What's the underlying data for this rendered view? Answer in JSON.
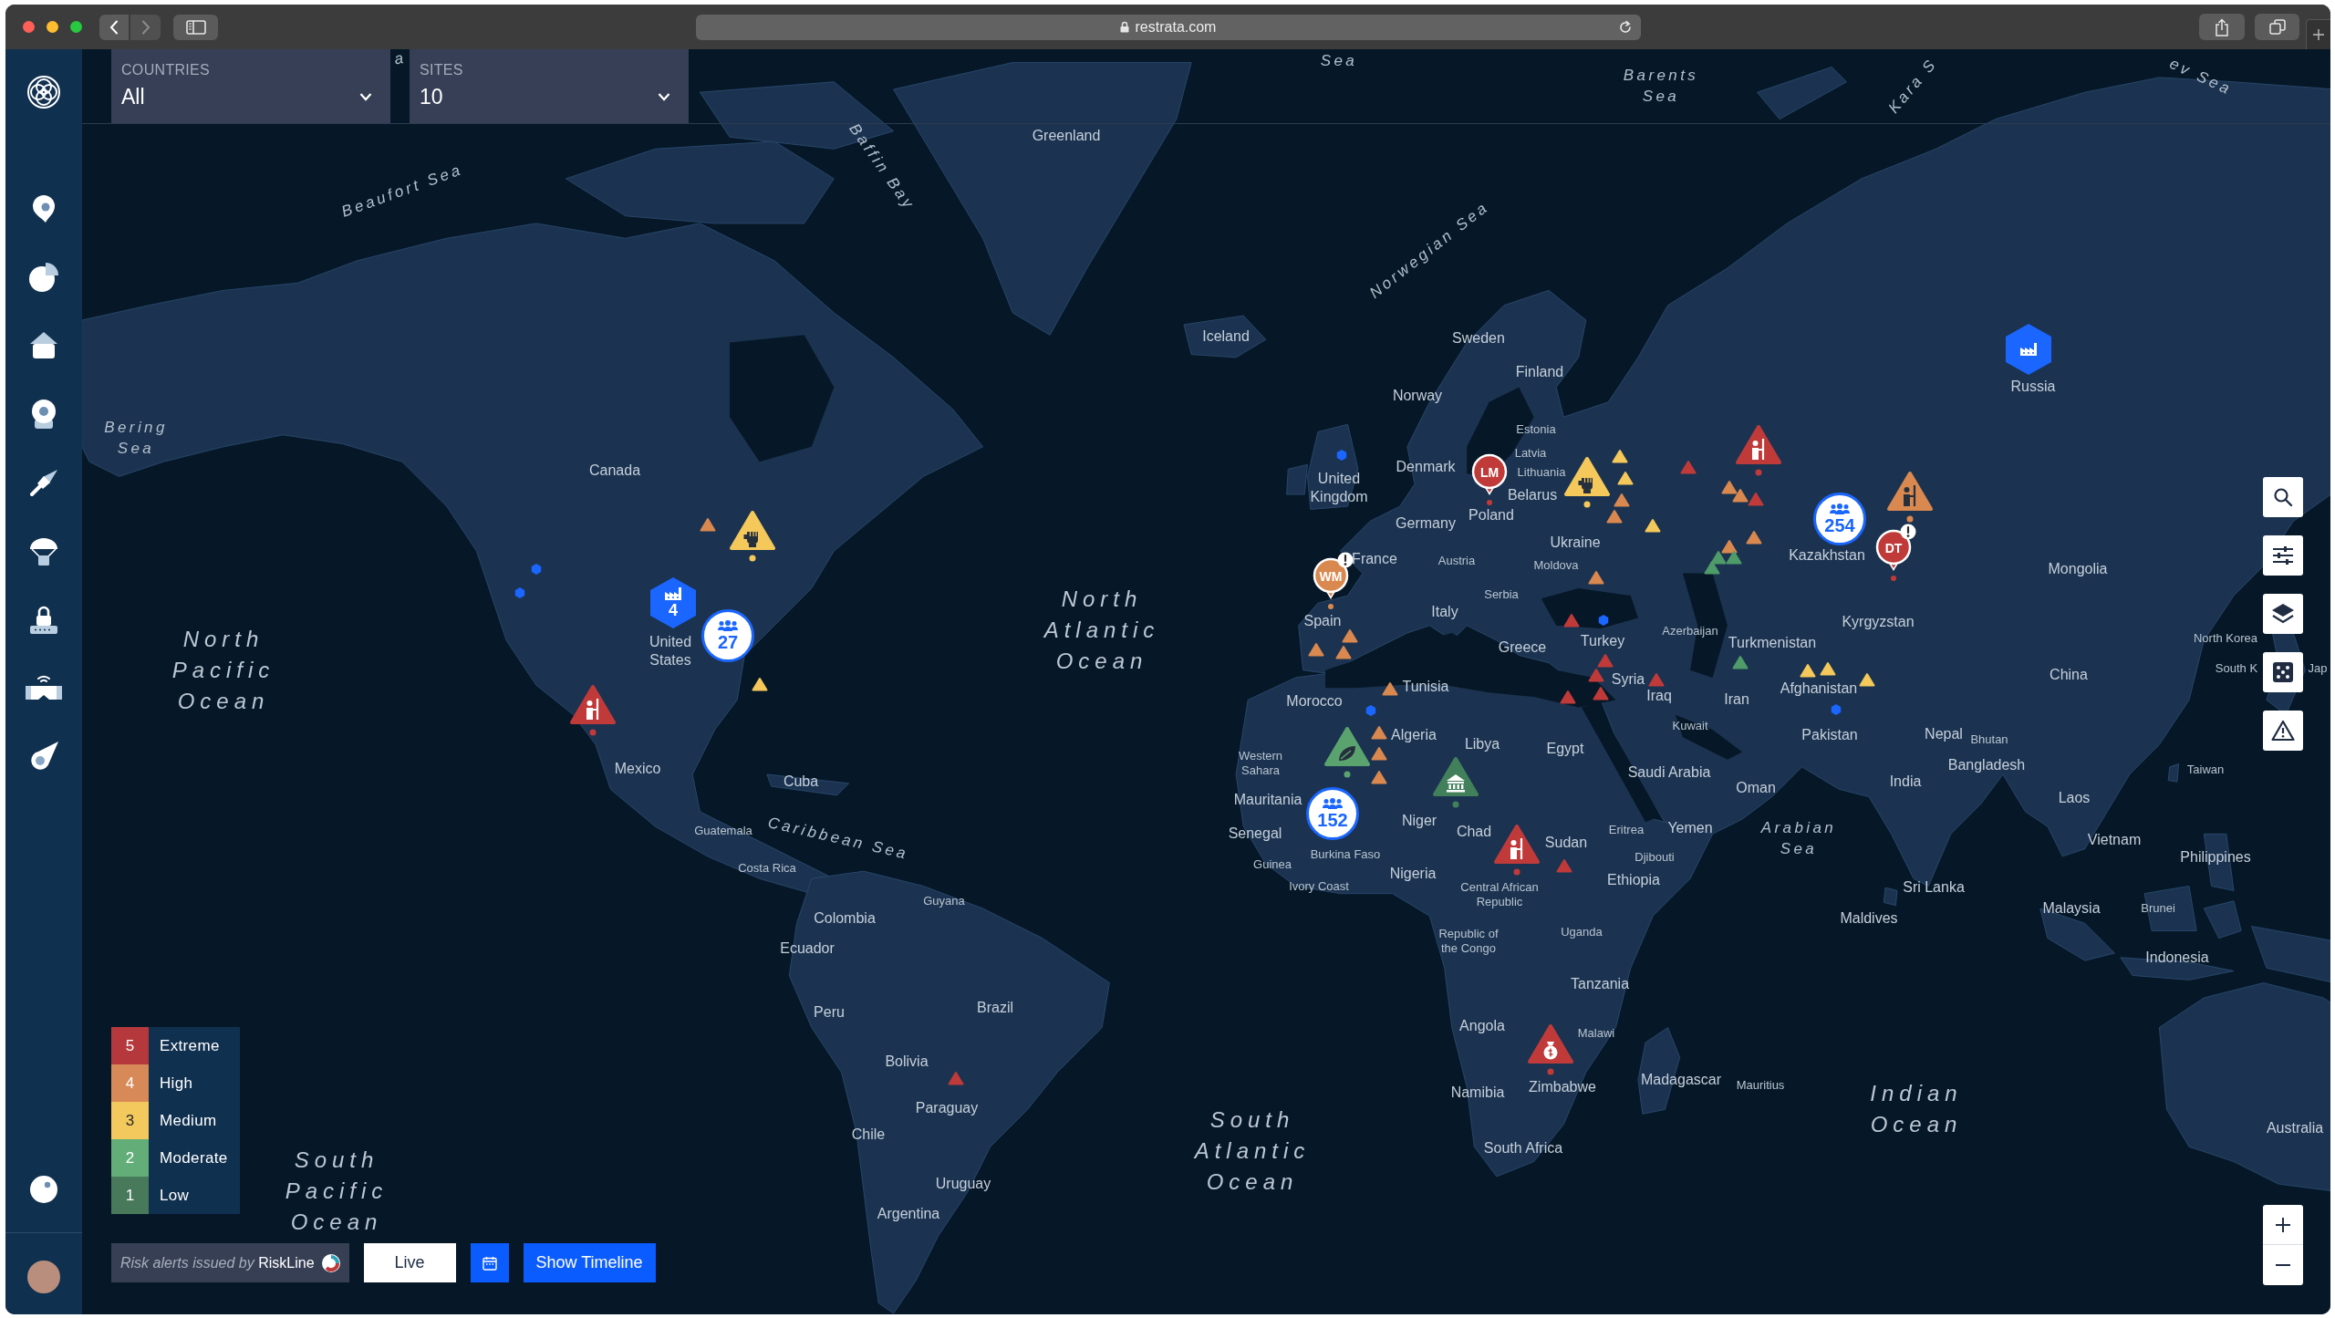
{
  "browser": {
    "url": "restrata.com"
  },
  "filters": [
    {
      "label": "COUNTRIES",
      "value": "All"
    },
    {
      "label": "SITES",
      "value": "10"
    }
  ],
  "map": {
    "labels": [
      {
        "text": "a",
        "kind": "sea"
      },
      {
        "text": "Sea",
        "kind": "sea"
      },
      {
        "text": "Barents Sea",
        "kind": "sea"
      },
      {
        "text": "Kara S",
        "kind": "sea"
      },
      {
        "text": "ev Sea",
        "kind": "sea"
      },
      {
        "text": "Greenland",
        "kind": "country"
      },
      {
        "text": "Beaufort Sea",
        "kind": "sea"
      },
      {
        "text": "Baffin Bay",
        "kind": "sea"
      },
      {
        "text": "Norwegian Sea",
        "kind": "sea"
      },
      {
        "text": "Iceland",
        "kind": "country"
      },
      {
        "text": "Sweden",
        "kind": "country"
      },
      {
        "text": "Finland",
        "kind": "country"
      },
      {
        "text": "Norway",
        "kind": "country"
      },
      {
        "text": "Russia",
        "kind": "country"
      },
      {
        "text": "Bering Sea",
        "kind": "sea"
      },
      {
        "text": "Estonia",
        "kind": "minor"
      },
      {
        "text": "Latvia",
        "kind": "minor"
      },
      {
        "text": "Canada",
        "kind": "country"
      },
      {
        "text": "Denmark",
        "kind": "country"
      },
      {
        "text": "Lithuania",
        "kind": "minor"
      },
      {
        "text": "United Kingdom",
        "kind": "country"
      },
      {
        "text": "Belarus",
        "kind": "country"
      },
      {
        "text": "Germany",
        "kind": "country"
      },
      {
        "text": "Poland",
        "kind": "country"
      },
      {
        "text": "Ukraine",
        "kind": "country"
      },
      {
        "text": "France",
        "kind": "country"
      },
      {
        "text": "Austria",
        "kind": "minor"
      },
      {
        "text": "Moldova",
        "kind": "minor"
      },
      {
        "text": "Kazakhstan",
        "kind": "country"
      },
      {
        "text": "Mongolia",
        "kind": "country"
      },
      {
        "text": "Serbia",
        "kind": "minor"
      },
      {
        "text": "Spain",
        "kind": "country"
      },
      {
        "text": "Italy",
        "kind": "country"
      },
      {
        "text": "Kyrgyzstan",
        "kind": "country"
      },
      {
        "text": "North Pacific Ocean",
        "kind": "ocean"
      },
      {
        "text": "United States",
        "kind": "country"
      },
      {
        "text": "North Atlantic Ocean",
        "kind": "ocean"
      },
      {
        "text": "Greece",
        "kind": "country"
      },
      {
        "text": "Turkey",
        "kind": "country"
      },
      {
        "text": "Azerbaijan",
        "kind": "minor"
      },
      {
        "text": "Turkmenistan",
        "kind": "country"
      },
      {
        "text": "North Korea",
        "kind": "minor"
      },
      {
        "text": "Morocco",
        "kind": "country"
      },
      {
        "text": "Tunisia",
        "kind": "country"
      },
      {
        "text": "Syria",
        "kind": "country"
      },
      {
        "text": "Iraq",
        "kind": "country"
      },
      {
        "text": "Iran",
        "kind": "country"
      },
      {
        "text": "Afghanistan",
        "kind": "country"
      },
      {
        "text": "China",
        "kind": "country"
      },
      {
        "text": "South K",
        "kind": "minor"
      },
      {
        "text": "Jap",
        "kind": "minor"
      },
      {
        "text": "Algeria",
        "kind": "country"
      },
      {
        "text": "Libya",
        "kind": "country"
      },
      {
        "text": "Egypt",
        "kind": "country"
      },
      {
        "text": "Kuwait",
        "kind": "minor"
      },
      {
        "text": "Pakistan",
        "kind": "country"
      },
      {
        "text": "Nepal",
        "kind": "country"
      },
      {
        "text": "Bhutan",
        "kind": "minor"
      },
      {
        "text": "Mexico",
        "kind": "country"
      },
      {
        "text": "Cuba",
        "kind": "country"
      },
      {
        "text": "Western Sahara",
        "kind": "minor"
      },
      {
        "text": "Saudi Arabia",
        "kind": "country"
      },
      {
        "text": "Oman",
        "kind": "country"
      },
      {
        "text": "India",
        "kind": "country"
      },
      {
        "text": "Bangladesh",
        "kind": "country"
      },
      {
        "text": "Taiwan",
        "kind": "minor"
      },
      {
        "text": "Mauritania",
        "kind": "country"
      },
      {
        "text": "Laos",
        "kind": "country"
      },
      {
        "text": "Guatemala",
        "kind": "minor"
      },
      {
        "text": "Caribbean Sea",
        "kind": "sea"
      },
      {
        "text": "Senegal",
        "kind": "country"
      },
      {
        "text": "Niger",
        "kind": "country"
      },
      {
        "text": "Chad",
        "kind": "country"
      },
      {
        "text": "Sudan",
        "kind": "country"
      },
      {
        "text": "Eritrea",
        "kind": "minor"
      },
      {
        "text": "Yemen",
        "kind": "country"
      },
      {
        "text": "Arabian Sea",
        "kind": "sea"
      },
      {
        "text": "Vietnam",
        "kind": "country"
      },
      {
        "text": "Costa Rica",
        "kind": "minor"
      },
      {
        "text": "Guinea",
        "kind": "minor"
      },
      {
        "text": "Burkina Faso",
        "kind": "minor"
      },
      {
        "text": "Nigeria",
        "kind": "country"
      },
      {
        "text": "Djibouti",
        "kind": "minor"
      },
      {
        "text": "Philippines",
        "kind": "country"
      },
      {
        "text": "Ivory Coast",
        "kind": "minor"
      },
      {
        "text": "Central African Republic",
        "kind": "minor"
      },
      {
        "text": "Ethiopia",
        "kind": "country"
      },
      {
        "text": "Sri Lanka",
        "kind": "country"
      },
      {
        "text": "Guyana",
        "kind": "minor"
      },
      {
        "text": "Malaysia",
        "kind": "country"
      },
      {
        "text": "Brunei",
        "kind": "minor"
      },
      {
        "text": "Colombia",
        "kind": "country"
      },
      {
        "text": "Maldives",
        "kind": "country"
      },
      {
        "text": "Ecuador",
        "kind": "country"
      },
      {
        "text": "Republic of the Congo",
        "kind": "minor"
      },
      {
        "text": "Uganda",
        "kind": "minor"
      },
      {
        "text": "Indonesia",
        "kind": "country"
      },
      {
        "text": "Tanzania",
        "kind": "country"
      },
      {
        "text": "Peru",
        "kind": "country"
      },
      {
        "text": "Brazil",
        "kind": "country"
      },
      {
        "text": "Angola",
        "kind": "country"
      },
      {
        "text": "Malawi",
        "kind": "minor"
      },
      {
        "text": "Bolivia",
        "kind": "country"
      },
      {
        "text": "Namibia",
        "kind": "country"
      },
      {
        "text": "Zimbabwe",
        "kind": "country"
      },
      {
        "text": "Madagascar",
        "kind": "country"
      },
      {
        "text": "Mauritius",
        "kind": "minor"
      },
      {
        "text": "Paraguay",
        "kind": "country"
      },
      {
        "text": "Indian Ocean",
        "kind": "ocean"
      },
      {
        "text": "Chile",
        "kind": "country"
      },
      {
        "text": "Australia",
        "kind": "country"
      },
      {
        "text": "South Atlantic Ocean",
        "kind": "ocean"
      },
      {
        "text": "South Africa",
        "kind": "country"
      },
      {
        "text": "South Pacific Ocean",
        "kind": "ocean"
      },
      {
        "text": "Uruguay",
        "kind": "country"
      },
      {
        "text": "Argentina",
        "kind": "country"
      }
    ],
    "markers": [
      {
        "kind": "protest",
        "color": "#f4c85a"
      },
      {
        "kind": "minor",
        "color": "#d9884f"
      },
      {
        "kind": "site",
        "count": "4"
      },
      {
        "kind": "cluster",
        "count": "27"
      },
      {
        "kind": "dot"
      },
      {
        "kind": "dot"
      },
      {
        "kind": "minor",
        "color": "#f4c85a"
      },
      {
        "kind": "armed",
        "color": "#c03a3a"
      },
      {
        "kind": "minor",
        "color": "#c03a3a"
      },
      {
        "kind": "site"
      },
      {
        "kind": "pin",
        "initials": "LM",
        "color": "#c03a3a",
        "flagged": false
      },
      {
        "kind": "dot"
      },
      {
        "kind": "protest",
        "color": "#f4c85a"
      },
      {
        "kind": "minor",
        "color": "#f4c85a"
      },
      {
        "kind": "minor",
        "color": "#f4c85a"
      },
      {
        "kind": "minor",
        "color": "#d9884f"
      },
      {
        "kind": "minor",
        "color": "#d9884f"
      },
      {
        "kind": "minor",
        "color": "#f4c85a"
      },
      {
        "kind": "minor",
        "color": "#c03a3a"
      },
      {
        "kind": "armed",
        "color": "#c03a3a"
      },
      {
        "kind": "minor",
        "color": "#d9884f"
      },
      {
        "kind": "minor",
        "color": "#d9884f"
      },
      {
        "kind": "minor",
        "color": "#c03a3a"
      },
      {
        "kind": "minor",
        "color": "#d9884f"
      },
      {
        "kind": "minor",
        "color": "#d9884f"
      },
      {
        "kind": "minor",
        "color": "#4f9b69"
      },
      {
        "kind": "minor",
        "color": "#4f9b69"
      },
      {
        "kind": "minor",
        "color": "#4f9b69"
      },
      {
        "kind": "cluster",
        "count": "254"
      },
      {
        "kind": "armed",
        "color": "#d9884f"
      },
      {
        "kind": "pin",
        "initials": "DT",
        "color": "#c03a3a",
        "flagged": true
      },
      {
        "kind": "pin",
        "initials": "WM",
        "color": "#d9884f",
        "flagged": true
      },
      {
        "kind": "minor",
        "color": "#d9884f"
      },
      {
        "kind": "minor",
        "color": "#c03a3a"
      },
      {
        "kind": "dot"
      },
      {
        "kind": "minor",
        "color": "#d9884f"
      },
      {
        "kind": "minor",
        "color": "#d9884f"
      },
      {
        "kind": "minor",
        "color": "#d9884f"
      },
      {
        "kind": "minor",
        "color": "#c03a3a"
      },
      {
        "kind": "minor",
        "color": "#c03a3a"
      },
      {
        "kind": "minor",
        "color": "#c03a3a"
      },
      {
        "kind": "minor",
        "color": "#c03a3a"
      },
      {
        "kind": "minor",
        "color": "#c03a3a"
      },
      {
        "kind": "minor",
        "color": "#4f9b69"
      },
      {
        "kind": "minor",
        "color": "#f4c85a"
      },
      {
        "kind": "minor",
        "color": "#f4c85a"
      },
      {
        "kind": "minor",
        "color": "#f4c85a"
      },
      {
        "kind": "dot"
      },
      {
        "kind": "minor",
        "color": "#d9884f"
      },
      {
        "kind": "dot"
      },
      {
        "kind": "environment",
        "color": "#5aa36f"
      },
      {
        "kind": "minor",
        "color": "#d9884f"
      },
      {
        "kind": "minor",
        "color": "#d9884f"
      },
      {
        "kind": "minor",
        "color": "#d9884f"
      },
      {
        "kind": "government",
        "color": "#42805b"
      },
      {
        "kind": "cluster",
        "count": "152"
      },
      {
        "kind": "armed",
        "color": "#c03a3a"
      },
      {
        "kind": "minor",
        "color": "#c03a3a"
      },
      {
        "kind": "financial",
        "color": "#c03a3a"
      }
    ]
  },
  "legend": [
    {
      "number": "5",
      "label": "Extreme",
      "color": "#b5393c"
    },
    {
      "number": "4",
      "label": "High",
      "color": "#d78a57"
    },
    {
      "number": "3",
      "label": "Medium",
      "color": "#f3c95d"
    },
    {
      "number": "2",
      "label": "Moderate",
      "color": "#63ad78"
    },
    {
      "number": "1",
      "label": "Low",
      "color": "#47795a"
    }
  ],
  "attribution": "*Risk alerts issued by* RiskLine",
  "controls": {
    "live_button": "Live",
    "timeline_button": "Show Timeline"
  }
}
